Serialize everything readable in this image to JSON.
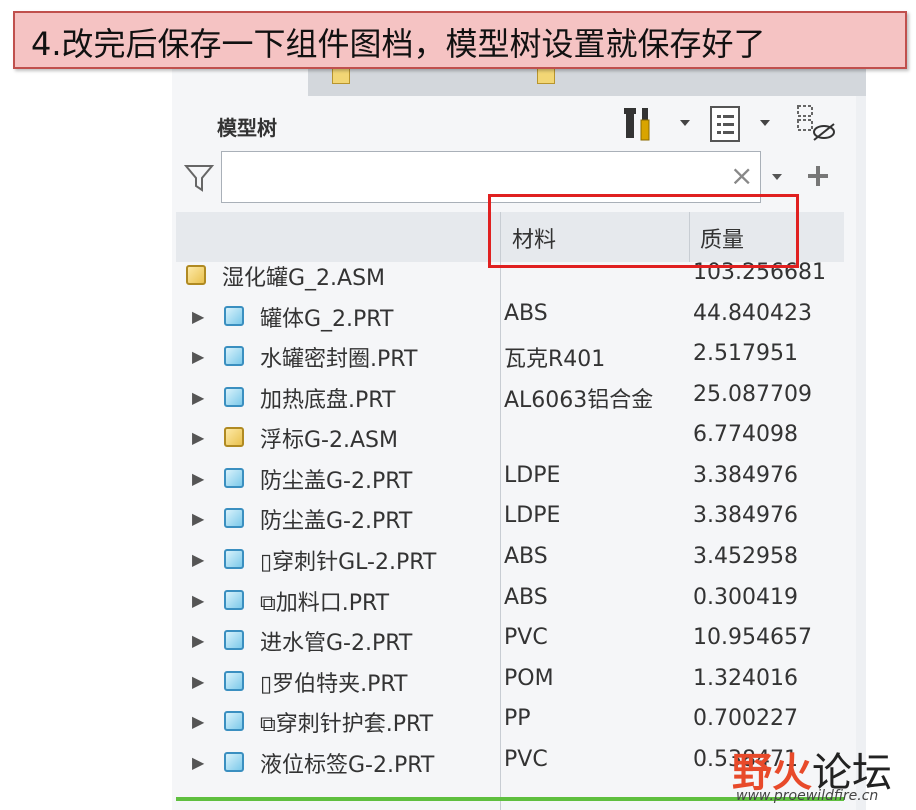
{
  "banner": {
    "text": "4.改完后保存一下组件图档，模型树设置就保存好了"
  },
  "panel": {
    "title": "模型树",
    "search": {
      "value": "",
      "clear_icon": "×"
    }
  },
  "columns": {
    "material": "材料",
    "mass": "质量"
  },
  "root": {
    "name": "湿化罐G_2.ASM",
    "material": "",
    "mass": "103.256681",
    "icon": "assembly-icon"
  },
  "rows": [
    {
      "name": "罐体G_2.PRT",
      "material": "ABS",
      "mass": "44.840423",
      "icon": "part-icon"
    },
    {
      "name": "水罐密封圈.PRT",
      "material": "瓦克R401",
      "mass": "2.517951",
      "icon": "part-icon"
    },
    {
      "name": "加热底盘.PRT",
      "material": "AL6063铝合金",
      "mass": "25.087709",
      "icon": "part-icon"
    },
    {
      "name": "浮标G-2.ASM",
      "material": "",
      "mass": "6.774098",
      "icon": "assembly-icon"
    },
    {
      "name": "防尘盖G-2.PRT",
      "material": "LDPE",
      "mass": "3.384976",
      "icon": "part-icon"
    },
    {
      "name": "防尘盖G-2.PRT",
      "material": "LDPE",
      "mass": "3.384976",
      "icon": "part-icon"
    },
    {
      "name": "▯穿刺针GL-2.PRT",
      "material": "ABS",
      "mass": "3.452958",
      "icon": "part-icon"
    },
    {
      "name": "⧉加料口.PRT",
      "material": "ABS",
      "mass": "0.300419",
      "icon": "part-icon"
    },
    {
      "name": "进水管G-2.PRT",
      "material": "PVC",
      "mass": "10.954657",
      "icon": "part-icon"
    },
    {
      "name": "▯罗伯特夹.PRT",
      "material": "POM",
      "mass": "1.324016",
      "icon": "part-icon"
    },
    {
      "name": "⧉穿刺针护套.PRT",
      "material": "PP",
      "mass": "0.700227",
      "icon": "part-icon"
    },
    {
      "name": "液位标签G-2.PRT",
      "material": "PVC",
      "mass": "0.538471",
      "icon": "part-icon"
    }
  ],
  "watermark": {
    "brand_red": "野火",
    "brand_dark": "论坛",
    "url": "www.proewildfire.cn"
  },
  "colors": {
    "highlight_box": "#e02020",
    "banner_bg": "#f5c3c3",
    "progress_line": "#5fbf3f"
  }
}
